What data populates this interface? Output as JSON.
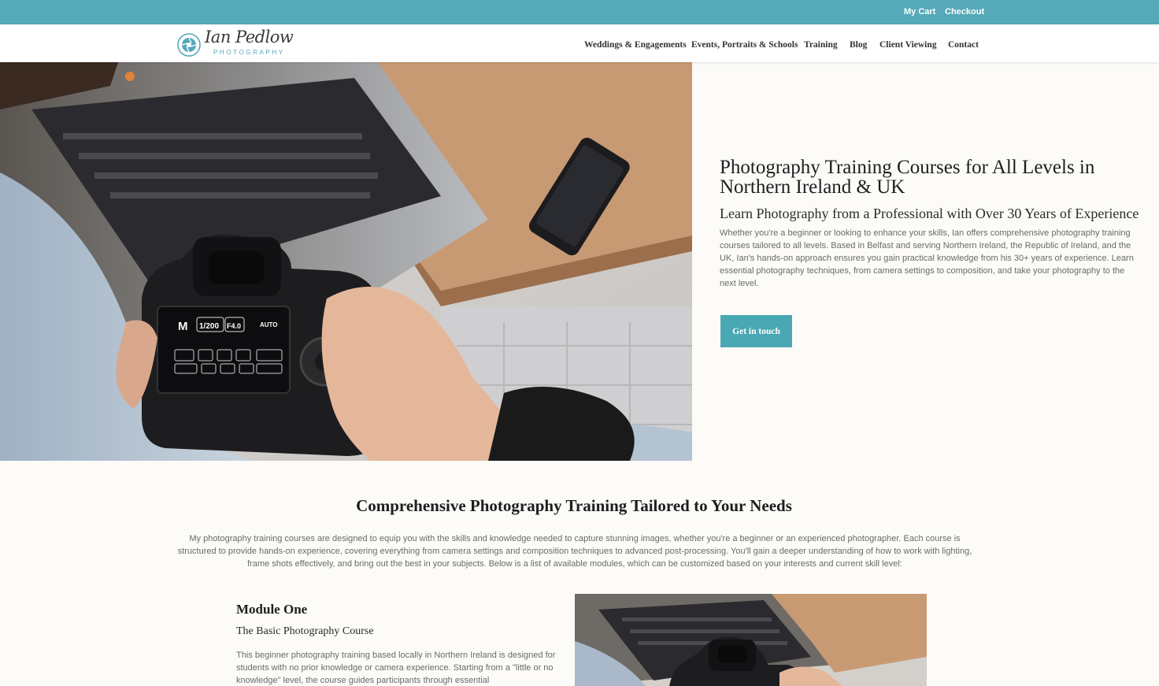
{
  "topbar": {
    "cart": "My Cart",
    "checkout": "Checkout"
  },
  "logo": {
    "script": "Ian Pedlow",
    "sub": "PHOTOGRAPHY"
  },
  "nav": {
    "items": [
      {
        "label": "Weddings & Engagements"
      },
      {
        "label": "Events, Portraits & Schools"
      },
      {
        "label": "Training"
      },
      {
        "label": "Blog"
      },
      {
        "label": "Client Viewing"
      },
      {
        "label": "Contact"
      }
    ]
  },
  "hero": {
    "title": "Photography Training Courses for All Levels in Northern Ireland & UK",
    "subtitle": "Learn Photography from a Professional with Over 30 Years of Experience",
    "body": "Whether you're a beginner or looking to enhance your skills, Ian offers comprehensive photography training courses tailored to all levels. Based in Belfast and serving Northern Ireland, the Republic of Ireland, and the UK, Ian's hands-on approach ensures you gain practical knowledge from his 30+ years of experience. Learn essential photography techniques, from camera settings to composition, and take your photography to the next level.",
    "button": "Get in touch"
  },
  "section": {
    "title": "Comprehensive Photography Training Tailored to Your Needs",
    "body": "My photography training courses are designed to equip you with the skills and knowledge needed to capture stunning images, whether you're a beginner or an experienced photographer. Each course is structured to provide hands-on experience, covering everything from camera settings and composition techniques to advanced post-processing. You'll gain a deeper understanding of how to work with lighting, frame shots effectively, and bring out the best in your subjects. Below is a list of available modules, which can be customized based on your interests and current skill level:"
  },
  "module": {
    "title": "Module One",
    "subtitle": "The Basic Photography Course",
    "body": "This beginner photography training based locally in Northern Ireland is designed for students with no prior knowledge or camera experience. Starting from a \"little or no knowledge\" level, the course guides participants through essential"
  },
  "camera_screen": {
    "mode": "M",
    "shutter": "1/200",
    "aperture": "F4.0",
    "iso": "AUTO"
  },
  "colors": {
    "accent": "#55a9b8",
    "button": "#4aa8b4"
  }
}
